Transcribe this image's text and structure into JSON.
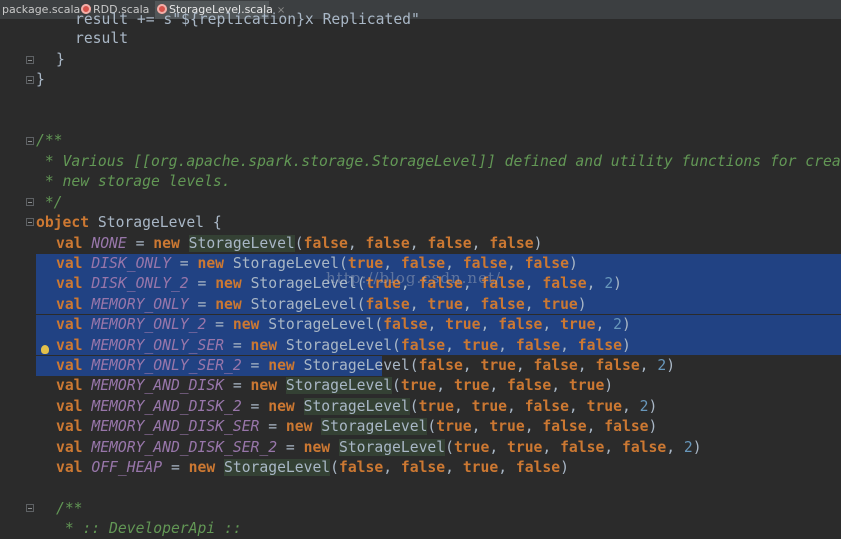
{
  "tabs": [
    {
      "label": "package.scala",
      "close": "×",
      "active": false
    },
    {
      "label": "RDD.scala",
      "close": "×",
      "active": false
    },
    {
      "label": "StorageLevel.scala",
      "close": "×",
      "active": true
    }
  ],
  "watermark": "http://blog.csdn.net/",
  "code": {
    "l0_a": "result += s\"${replication}x Replicated\"",
    "l1": "result",
    "l2": "}",
    "l3": "}",
    "doc1": "/**",
    "doc2": " * Various [[org.apache.spark.storage.StorageLevel]] defined and utility functions for creating",
    "doc3": " * new storage levels.",
    "doc4": " */",
    "obj_kw": "object",
    "obj_name": " StorageLevel {",
    "lines": [
      {
        "name": "NONE",
        "args": [
          "false",
          "false",
          "false",
          "false"
        ],
        "rep": ""
      },
      {
        "name": "DISK_ONLY",
        "args": [
          "true",
          "false",
          "false",
          "false"
        ],
        "rep": ""
      },
      {
        "name": "DISK_ONLY_2",
        "args": [
          "true",
          "false",
          "false",
          "false"
        ],
        "rep": "2"
      },
      {
        "name": "MEMORY_ONLY",
        "args": [
          "false",
          "true",
          "false",
          "true"
        ],
        "rep": ""
      },
      {
        "name": "MEMORY_ONLY_2",
        "args": [
          "false",
          "true",
          "false",
          "true"
        ],
        "rep": "2"
      },
      {
        "name": "MEMORY_ONLY_SER",
        "args": [
          "false",
          "true",
          "false",
          "false"
        ],
        "rep": ""
      },
      {
        "name": "MEMORY_ONLY_SER_2",
        "args": [
          "false",
          "true",
          "false",
          "false"
        ],
        "rep": "2"
      },
      {
        "name": "MEMORY_AND_DISK",
        "args": [
          "true",
          "true",
          "false",
          "true"
        ],
        "rep": ""
      },
      {
        "name": "MEMORY_AND_DISK_2",
        "args": [
          "true",
          "true",
          "false",
          "true"
        ],
        "rep": "2"
      },
      {
        "name": "MEMORY_AND_DISK_SER",
        "args": [
          "true",
          "true",
          "false",
          "false"
        ],
        "rep": ""
      },
      {
        "name": "MEMORY_AND_DISK_SER_2",
        "args": [
          "true",
          "true",
          "false",
          "false"
        ],
        "rep": "2"
      },
      {
        "name": "OFF_HEAP",
        "args": [
          "false",
          "false",
          "true",
          "false"
        ],
        "rep": ""
      }
    ],
    "doc5": "/**",
    "doc6": " * :: DeveloperApi ::"
  },
  "tokens": {
    "val": "val",
    "eq": " = ",
    "new": "new",
    "cls": "StorageLevel"
  },
  "colors": {
    "background": "#2b2b2b",
    "keyword": "#cc7832",
    "field": "#9876aa",
    "number": "#6897bb",
    "doc": "#629755",
    "selection": "#214283"
  }
}
